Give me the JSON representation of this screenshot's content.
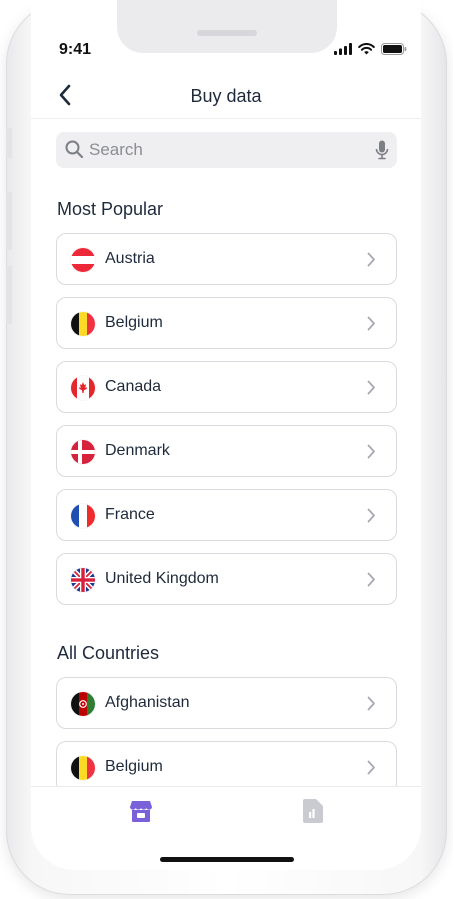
{
  "status_bar": {
    "time": "9:41"
  },
  "header": {
    "title": "Buy data"
  },
  "search": {
    "placeholder": "Search"
  },
  "sections": {
    "popular_title": "Most Popular",
    "all_title": "All Countries"
  },
  "popular": [
    {
      "name": "Austria",
      "flag": "austria-flag-icon"
    },
    {
      "name": "Belgium",
      "flag": "belgium-flag-icon"
    },
    {
      "name": "Canada",
      "flag": "canada-flag-icon"
    },
    {
      "name": "Denmark",
      "flag": "denmark-flag-icon"
    },
    {
      "name": "France",
      "flag": "france-flag-icon"
    },
    {
      "name": "United Kingdom",
      "flag": "uk-flag-icon"
    }
  ],
  "all_countries": [
    {
      "name": "Afghanistan",
      "flag": "afghanistan-flag-icon"
    },
    {
      "name": "Belgium",
      "flag": "belgium-flag-icon"
    }
  ],
  "tabbar": {
    "items": [
      {
        "icon": "store-icon",
        "active": true
      },
      {
        "icon": "sim-card-icon",
        "active": false
      }
    ]
  },
  "colors": {
    "accent": "#7b61d9",
    "text": "#1e2a3b",
    "muted": "#8a8d93",
    "border": "#d9dbe0"
  }
}
